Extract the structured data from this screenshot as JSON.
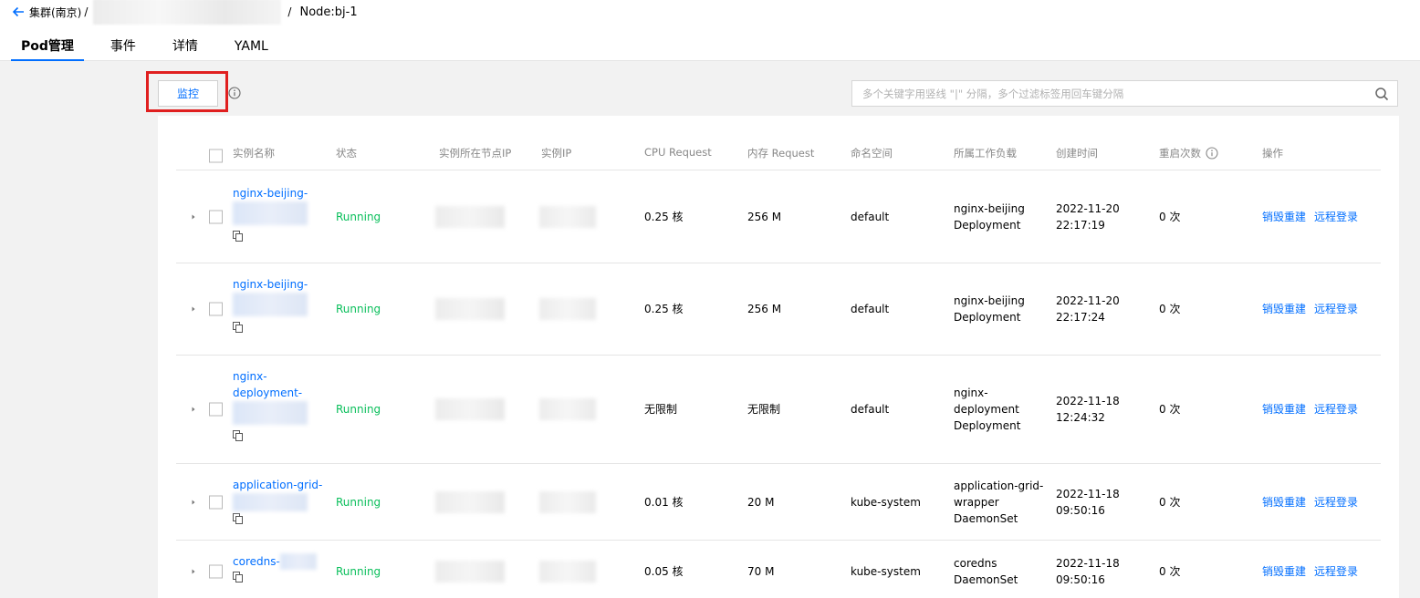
{
  "breadcrumb": {
    "cluster": "集群(南京)",
    "separator": "/",
    "current": "Node:bj-1"
  },
  "tabs": [
    {
      "label": "Pod管理",
      "active": true
    },
    {
      "label": "事件",
      "active": false
    },
    {
      "label": "详情",
      "active": false
    },
    {
      "label": "YAML",
      "active": false
    }
  ],
  "toolbar": {
    "monitor_label": "监控",
    "search_placeholder": "多个关键字用竖线 \"|\" 分隔，多个过滤标签用回车键分隔"
  },
  "table": {
    "headers": {
      "name": "实例名称",
      "status": "状态",
      "node_ip": "实例所在节点IP",
      "pod_ip": "实例IP",
      "cpu": "CPU Request",
      "mem": "内存 Request",
      "namespace": "命名空间",
      "workload": "所属工作负载",
      "created": "创建时间",
      "restarts": "重启次数",
      "actions": "操作"
    },
    "rows": [
      {
        "name": [
          "nginx-beijing-"
        ],
        "status": "Running",
        "cpu": "0.25 核",
        "mem": "256 M",
        "namespace": "default",
        "workload": [
          "nginx-beijing",
          "Deployment"
        ],
        "created": [
          "2022-11-20",
          "22:17:19"
        ],
        "restarts": "0 次",
        "action1": "销毁重建",
        "action2": "远程登录"
      },
      {
        "name": [
          "nginx-beijing-"
        ],
        "status": "Running",
        "cpu": "0.25 核",
        "mem": "256 M",
        "namespace": "default",
        "workload": [
          "nginx-beijing",
          "Deployment"
        ],
        "created": [
          "2022-11-20",
          "22:17:24"
        ],
        "restarts": "0 次",
        "action1": "销毁重建",
        "action2": "远程登录"
      },
      {
        "name": [
          "nginx-",
          "deployment-"
        ],
        "status": "Running",
        "cpu": "无限制",
        "mem": "无限制",
        "namespace": "default",
        "workload": [
          "nginx-",
          "deployment",
          "Deployment"
        ],
        "created": [
          "2022-11-18",
          "12:24:32"
        ],
        "restarts": "0 次",
        "action1": "销毁重建",
        "action2": "远程登录"
      },
      {
        "name": [
          "application-grid-"
        ],
        "status": "Running",
        "cpu": "0.01 核",
        "mem": "20 M",
        "namespace": "kube-system",
        "workload": [
          "application-grid-",
          "wrapper",
          "DaemonSet"
        ],
        "created": [
          "2022-11-18",
          "09:50:16"
        ],
        "restarts": "0 次",
        "action1": "销毁重建",
        "action2": "远程登录"
      },
      {
        "name": [
          "coredns-"
        ],
        "status": "Running",
        "cpu": "0.05 核",
        "mem": "70 M",
        "namespace": "kube-system",
        "workload": [
          "coredns",
          "DaemonSet"
        ],
        "created": [
          "2022-11-18",
          "09:50:16"
        ],
        "restarts": "0 次",
        "action1": "销毁重建",
        "action2": "远程登录"
      }
    ]
  }
}
